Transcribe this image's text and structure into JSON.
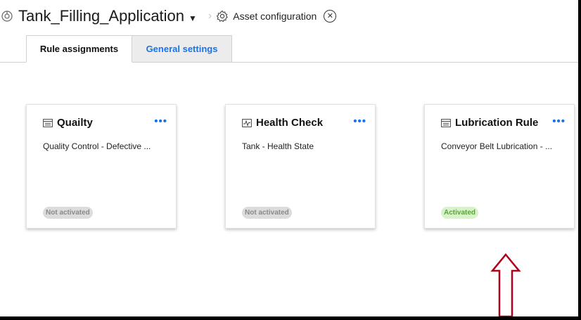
{
  "header": {
    "app_title": "Tank_Filling_Application",
    "crumb_label": "Asset configuration",
    "icons": [
      "app-icon",
      "caret-down-icon",
      "chevron-right-icon",
      "gear-icon",
      "close-circle-icon"
    ]
  },
  "tabs": [
    {
      "label": "Rule assignments",
      "active": true
    },
    {
      "label": "General settings",
      "active": false
    }
  ],
  "cards": [
    {
      "title": "Quailty",
      "icon": "rule-list-icon",
      "description": "Quality Control - Defective ...",
      "status": "Not activated"
    },
    {
      "title": "Health Check",
      "icon": "pulse-chart-icon",
      "description": "Tank - Health State",
      "status": "Not activated"
    },
    {
      "title": "Lubrication Rule",
      "icon": "rule-list-icon",
      "description": "Conveyor Belt Lubrication - ...",
      "status": "Activated"
    }
  ],
  "more_label": "•••",
  "colors": {
    "accent": "#1a73e8",
    "annotation_arrow": "#b0001a",
    "active_badge_bg": "#d9f2cc",
    "inactive_badge_bg": "#dcdcdc"
  }
}
